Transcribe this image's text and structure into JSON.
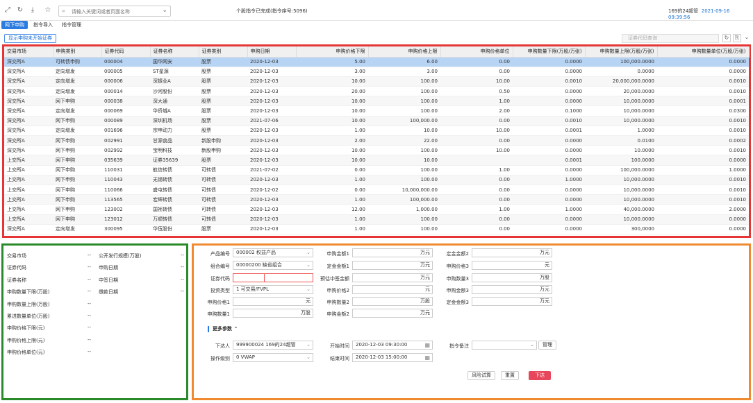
{
  "topbar": {
    "search_placeholder": "请输入关键词或者页面名称",
    "status_msg": "个股指令已完成(指令序号:5096)",
    "user": "169的24超管",
    "datetime": "2021-09-16 09:39:56"
  },
  "menu": [
    {
      "label": "网下申购",
      "active": true
    },
    {
      "label": "指令导入",
      "active": false
    },
    {
      "label": "指令管理",
      "active": false
    }
  ],
  "toolbar": {
    "filter_label": "显示申购未开始证券",
    "code_query_placeholder": "证券代码查询"
  },
  "table": {
    "columns": [
      "交易市场",
      "申购类别",
      "证券代码",
      "证券名称",
      "证券类别",
      "申购日期",
      "申购价格下限",
      "申购价格上限",
      "申购价格单位",
      "申购数量下限(万股/万张)",
      "申购数量上限(万股/万张)",
      "申购数量单位(万股/万张)"
    ],
    "rows": [
      [
        "深交所A",
        "可转债申购",
        "000004",
        "国华网安",
        "股票",
        "2020-12-03",
        "5.00",
        "6.00",
        "0.00",
        "0.0000",
        "100,000.0000",
        "0.0000"
      ],
      [
        "深交所A",
        "定向增发",
        "000005",
        "ST星源",
        "股票",
        "2020-12-03",
        "3.00",
        "3.00",
        "0.00",
        "0.0000",
        "0.0000",
        "0.0000"
      ],
      [
        "深交所A",
        "定向增发",
        "000006",
        "深振业A",
        "股票",
        "2020-12-03",
        "10.00",
        "100.00",
        "10.00",
        "0.0010",
        "20,000,000.0000",
        "0.0010"
      ],
      [
        "深交所A",
        "定向增发",
        "000014",
        "沙河股份",
        "股票",
        "2020-12-03",
        "20.00",
        "100.00",
        "0.50",
        "0.0000",
        "20,000.0000",
        "0.0010"
      ],
      [
        "深交所A",
        "网下申购",
        "000038",
        "深大通",
        "股票",
        "2020-12-03",
        "10.00",
        "100.00",
        "1.00",
        "0.0000",
        "10,000.0000",
        "0.0001"
      ],
      [
        "深交所A",
        "定向增发",
        "000069",
        "华侨城A",
        "股票",
        "2020-12-03",
        "10.00",
        "100.00",
        "2.00",
        "0.1000",
        "10,000.0000",
        "0.0300"
      ],
      [
        "深交所A",
        "网下申购",
        "000089",
        "深圳机场",
        "股票",
        "2021-07-06",
        "10.00",
        "100,000.00",
        "0.00",
        "0.0010",
        "10,000.0000",
        "0.0010"
      ],
      [
        "深交所A",
        "定向增发",
        "001696",
        "宗申动力",
        "股票",
        "2020-12-03",
        "1.00",
        "10.00",
        "10.00",
        "0.0001",
        "1.0000",
        "0.0010"
      ],
      [
        "深交所A",
        "网下申购",
        "002991",
        "甘源食品",
        "新股申购",
        "2020-12-03",
        "2.00",
        "22.00",
        "0.00",
        "0.0000",
        "0.0100",
        "0.0002"
      ],
      [
        "深交所A",
        "网下申购",
        "002992",
        "宝明科技",
        "新股申购",
        "2020-12-03",
        "10.00",
        "100.00",
        "10.00",
        "0.0000",
        "10.0000",
        "0.0010"
      ],
      [
        "上交所A",
        "网下申购",
        "035639",
        "证券35639",
        "股票",
        "2020-12-03",
        "10.00",
        "10.00",
        "",
        "0.0001",
        "100.0000",
        "0.0000"
      ],
      [
        "上交所A",
        "网下申购",
        "110031",
        "航信转债",
        "可转债",
        "2021-07-02",
        "0.00",
        "100.00",
        "1.00",
        "0.0000",
        "100,000.0000",
        "1.0000"
      ],
      [
        "上交所A",
        "网下申购",
        "110043",
        "无锡转债",
        "可转债",
        "2020-12-03",
        "1.00",
        "100.00",
        "0.00",
        "1.0000",
        "10,000.0000",
        "0.0010"
      ],
      [
        "上交所A",
        "网下申购",
        "110066",
        "盛屯转债",
        "可转债",
        "2020-12-02",
        "0.00",
        "10,000,000.00",
        "0.00",
        "0.0000",
        "10,000.0000",
        "0.0010"
      ],
      [
        "上交所A",
        "网下申购",
        "113565",
        "宏辉转债",
        "可转债",
        "2020-12-03",
        "1.00",
        "100,000.00",
        "0.00",
        "0.0000",
        "10,000.0000",
        "0.0010"
      ],
      [
        "上交所A",
        "网下申购",
        "123002",
        "国祯转债",
        "可转债",
        "2020-12-03",
        "12.00",
        "1,000.00",
        "1.00",
        "1.0000",
        "40,000.0000",
        "2.0000"
      ],
      [
        "上交所A",
        "网下申购",
        "123012",
        "万顺转债",
        "可转债",
        "2020-12-03",
        "1.00",
        "100.00",
        "0.00",
        "0.0000",
        "10,000.0000",
        "0.0000"
      ],
      [
        "深交所A",
        "定向增发",
        "300095",
        "华伍股份",
        "股票",
        "2020-12-03",
        "1.00",
        "100.00",
        "0.00",
        "0.0000",
        "300,0000",
        "0.0000"
      ]
    ]
  },
  "detail": {
    "left": [
      {
        "label": "交易市场",
        "value": "--"
      },
      {
        "label": "证券代码",
        "value": "--"
      },
      {
        "label": "证券名称",
        "value": "--"
      },
      {
        "label": "申购数量下限(万股)",
        "value": "--"
      },
      {
        "label": "申购数量上限(万股)",
        "value": "--"
      },
      {
        "label": "累进数量单位(万股)",
        "value": "--"
      },
      {
        "label": "申购价格下限(元)",
        "value": "--"
      },
      {
        "label": "申购价格上限(元)",
        "value": "--"
      },
      {
        "label": "申购价格单位(元)",
        "value": "--"
      }
    ],
    "right": [
      {
        "label": "公开发行规模(万股)",
        "value": "--"
      },
      {
        "label": "申购日期",
        "value": "--"
      },
      {
        "label": "中签日期",
        "value": "--"
      },
      {
        "label": "缴款日期",
        "value": "--"
      }
    ]
  },
  "form": {
    "product_label": "产品编号",
    "product_value": "000002 权益产品",
    "portfolio_label": "组合编号",
    "portfolio_value": "00000200 缺省组合",
    "code_label": "证券代码",
    "invest_type_label": "投资类型",
    "invest_type_value": "1 可交易/FVPL",
    "price1_label": "申购价格1",
    "price_unit": "元",
    "qty1_label": "申购数量1",
    "qty_unit": "万股",
    "amount1_label": "申购金额1",
    "amount_unit": "万元",
    "deposit1_label": "定金金额1",
    "est_lot_label": "预估中签金额",
    "price2_label": "申购价格2",
    "qty2_label": "申购数量2",
    "amount2_label": "申购金额2",
    "deposit2_label": "定金金额2",
    "price3_label": "申购价格3",
    "qty3_label": "申购数量3",
    "amount3_label": "申购金额3",
    "deposit3_label": "定金金额3",
    "more_params": "更多参数",
    "issuer_label": "下达人",
    "issuer_value": "999900024 169的24超管",
    "level_label": "操作级别",
    "level_value": "0 VWAP",
    "start_label": "开始时间",
    "start_value": "2020-12-03 09:30:00",
    "end_label": "结束时间",
    "end_value": "2020-12-03 15:00:00",
    "note_label": "指令备注",
    "manage_label": "管理",
    "risk_label": "风险试算",
    "reset_label": "重置",
    "submit_label": "下达"
  }
}
